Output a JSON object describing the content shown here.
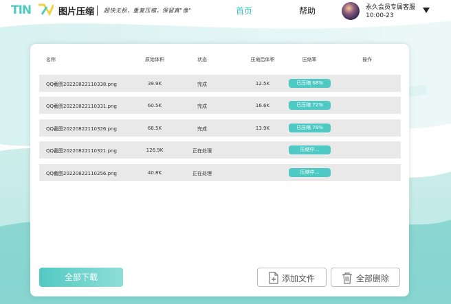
{
  "header": {
    "app_title": "图片压缩",
    "slogan": "超快无损，重复压缩，保留真\"像\"",
    "nav_home": "首页",
    "nav_help": "帮助",
    "vip_label": "永久会员专属客服",
    "vip_time": "10:00-23",
    "colors": {
      "accent": "#3fc3bf",
      "logo_green": "#52c9c2",
      "logo_yellow": "#f2d13c"
    }
  },
  "table": {
    "headers": {
      "name": "名称",
      "original_size": "原始体积",
      "status": "状态",
      "compressed_size": "压缩后体积",
      "ratio": "压缩率",
      "actions": "操作"
    },
    "rows": [
      {
        "name": "QQ截图20220822110338.png",
        "original_size": "39.9K",
        "status": "完成",
        "compressed_size": "12.5K",
        "ratio": "已压缩 68%"
      },
      {
        "name": "QQ截图20220822110331.png",
        "original_size": "60.5K",
        "status": "完成",
        "compressed_size": "16.6K",
        "ratio": "已压缩 72%"
      },
      {
        "name": "QQ截图20220822110326.png",
        "original_size": "68.5K",
        "status": "完成",
        "compressed_size": "13.9K",
        "ratio": "已压缩 79%"
      },
      {
        "name": "QQ截图20220822110321.png",
        "original_size": "126.9K",
        "status": "正在处理",
        "compressed_size": "",
        "ratio": "压缩中..."
      },
      {
        "name": "QQ截图20220822110256.png",
        "original_size": "40.8K",
        "status": "正在处理",
        "compressed_size": "",
        "ratio": "压缩中..."
      }
    ]
  },
  "buttons": {
    "download_all": "全部下载",
    "add_file": "添加文件",
    "delete_all": "全部删除"
  }
}
